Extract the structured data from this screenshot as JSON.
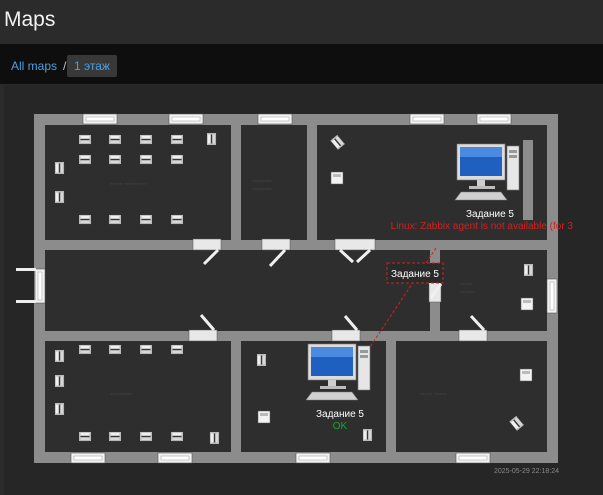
{
  "header": {
    "title": "Maps"
  },
  "breadcrumb": {
    "all_maps": "All maps",
    "separator": "/",
    "current": "1 этаж"
  },
  "map": {
    "hosts": [
      {
        "name": "Задание 5",
        "status": "Linux: Zabbix agent is not available (for 3",
        "status_color": "#d22020"
      },
      {
        "name": "Задание 5",
        "status": "OK",
        "status_color": "#00b12e"
      }
    ],
    "selected_label": "Задание 5",
    "timestamp": "2025-05-29 22:18:24",
    "colors": {
      "wall": "#8c8c8c",
      "floor": "#2e2e2e",
      "link_problem": "#d22020"
    }
  }
}
